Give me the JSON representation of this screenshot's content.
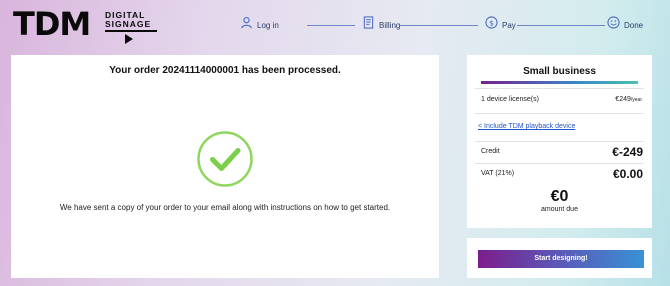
{
  "logo": {
    "wordmark": "TDM",
    "tagline_line1": "DIGITAL",
    "tagline_line2": "SIGNAGE"
  },
  "steps": [
    {
      "label": "Log in",
      "icon": "user-icon"
    },
    {
      "label": "Billing",
      "icon": "document-icon"
    },
    {
      "label": "Pay",
      "icon": "dollar-icon"
    },
    {
      "label": "Done",
      "icon": "smile-icon"
    }
  ],
  "main": {
    "title": "Your order 20241114000001 has been processed.",
    "message": "We have sent a copy of your order to your email along with instructions on how to get started.",
    "icon": "checkmark-circle-icon"
  },
  "summary": {
    "plan": "Small business",
    "license_label": "1 device license(s)",
    "license_price": "€249",
    "license_period": "/year",
    "include_link": "< Include TDM playback device",
    "credit_label": "Credit",
    "credit_value": "€-249",
    "vat_label": "VAT (21%)",
    "vat_value": "€0.00",
    "total": "€0",
    "total_label": "amount due"
  },
  "actions": {
    "start_label": "Start designing!"
  },
  "colors": {
    "accent_purple": "#7d1d8c",
    "accent_blue": "#3a92d6",
    "check_green": "#7ccf4a",
    "step_color": "#2b3b6a"
  }
}
